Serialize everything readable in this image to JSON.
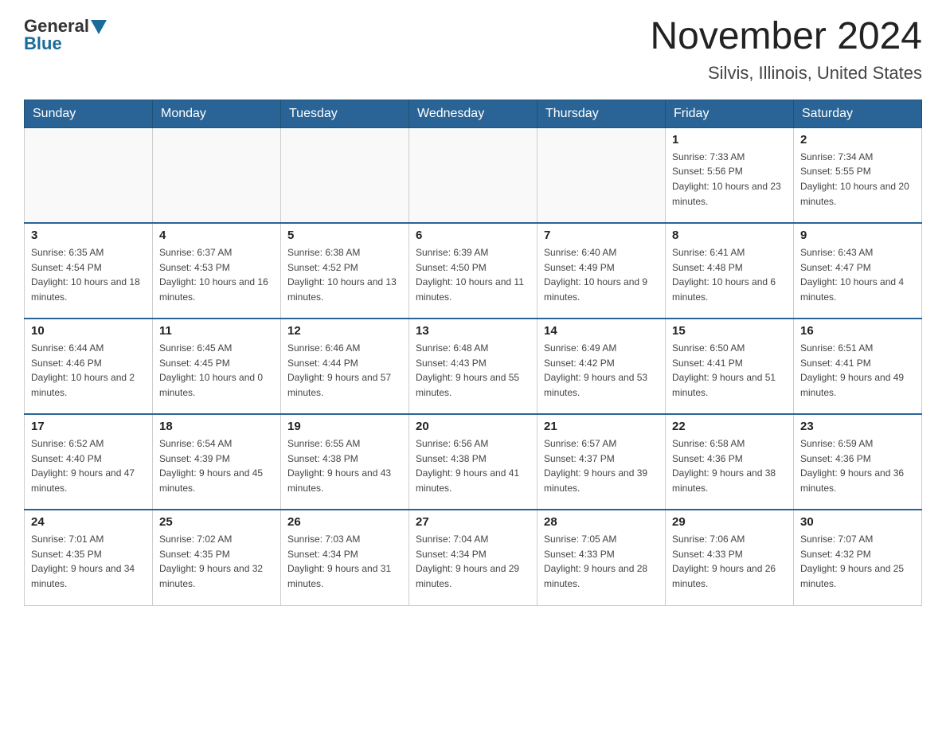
{
  "logo": {
    "general_text": "General",
    "blue_text": "Blue"
  },
  "header": {
    "month_year": "November 2024",
    "location": "Silvis, Illinois, United States"
  },
  "weekdays": [
    "Sunday",
    "Monday",
    "Tuesday",
    "Wednesday",
    "Thursday",
    "Friday",
    "Saturday"
  ],
  "weeks": [
    [
      {
        "day": "",
        "info": ""
      },
      {
        "day": "",
        "info": ""
      },
      {
        "day": "",
        "info": ""
      },
      {
        "day": "",
        "info": ""
      },
      {
        "day": "",
        "info": ""
      },
      {
        "day": "1",
        "info": "Sunrise: 7:33 AM\nSunset: 5:56 PM\nDaylight: 10 hours and 23 minutes."
      },
      {
        "day": "2",
        "info": "Sunrise: 7:34 AM\nSunset: 5:55 PM\nDaylight: 10 hours and 20 minutes."
      }
    ],
    [
      {
        "day": "3",
        "info": "Sunrise: 6:35 AM\nSunset: 4:54 PM\nDaylight: 10 hours and 18 minutes."
      },
      {
        "day": "4",
        "info": "Sunrise: 6:37 AM\nSunset: 4:53 PM\nDaylight: 10 hours and 16 minutes."
      },
      {
        "day": "5",
        "info": "Sunrise: 6:38 AM\nSunset: 4:52 PM\nDaylight: 10 hours and 13 minutes."
      },
      {
        "day": "6",
        "info": "Sunrise: 6:39 AM\nSunset: 4:50 PM\nDaylight: 10 hours and 11 minutes."
      },
      {
        "day": "7",
        "info": "Sunrise: 6:40 AM\nSunset: 4:49 PM\nDaylight: 10 hours and 9 minutes."
      },
      {
        "day": "8",
        "info": "Sunrise: 6:41 AM\nSunset: 4:48 PM\nDaylight: 10 hours and 6 minutes."
      },
      {
        "day": "9",
        "info": "Sunrise: 6:43 AM\nSunset: 4:47 PM\nDaylight: 10 hours and 4 minutes."
      }
    ],
    [
      {
        "day": "10",
        "info": "Sunrise: 6:44 AM\nSunset: 4:46 PM\nDaylight: 10 hours and 2 minutes."
      },
      {
        "day": "11",
        "info": "Sunrise: 6:45 AM\nSunset: 4:45 PM\nDaylight: 10 hours and 0 minutes."
      },
      {
        "day": "12",
        "info": "Sunrise: 6:46 AM\nSunset: 4:44 PM\nDaylight: 9 hours and 57 minutes."
      },
      {
        "day": "13",
        "info": "Sunrise: 6:48 AM\nSunset: 4:43 PM\nDaylight: 9 hours and 55 minutes."
      },
      {
        "day": "14",
        "info": "Sunrise: 6:49 AM\nSunset: 4:42 PM\nDaylight: 9 hours and 53 minutes."
      },
      {
        "day": "15",
        "info": "Sunrise: 6:50 AM\nSunset: 4:41 PM\nDaylight: 9 hours and 51 minutes."
      },
      {
        "day": "16",
        "info": "Sunrise: 6:51 AM\nSunset: 4:41 PM\nDaylight: 9 hours and 49 minutes."
      }
    ],
    [
      {
        "day": "17",
        "info": "Sunrise: 6:52 AM\nSunset: 4:40 PM\nDaylight: 9 hours and 47 minutes."
      },
      {
        "day": "18",
        "info": "Sunrise: 6:54 AM\nSunset: 4:39 PM\nDaylight: 9 hours and 45 minutes."
      },
      {
        "day": "19",
        "info": "Sunrise: 6:55 AM\nSunset: 4:38 PM\nDaylight: 9 hours and 43 minutes."
      },
      {
        "day": "20",
        "info": "Sunrise: 6:56 AM\nSunset: 4:38 PM\nDaylight: 9 hours and 41 minutes."
      },
      {
        "day": "21",
        "info": "Sunrise: 6:57 AM\nSunset: 4:37 PM\nDaylight: 9 hours and 39 minutes."
      },
      {
        "day": "22",
        "info": "Sunrise: 6:58 AM\nSunset: 4:36 PM\nDaylight: 9 hours and 38 minutes."
      },
      {
        "day": "23",
        "info": "Sunrise: 6:59 AM\nSunset: 4:36 PM\nDaylight: 9 hours and 36 minutes."
      }
    ],
    [
      {
        "day": "24",
        "info": "Sunrise: 7:01 AM\nSunset: 4:35 PM\nDaylight: 9 hours and 34 minutes."
      },
      {
        "day": "25",
        "info": "Sunrise: 7:02 AM\nSunset: 4:35 PM\nDaylight: 9 hours and 32 minutes."
      },
      {
        "day": "26",
        "info": "Sunrise: 7:03 AM\nSunset: 4:34 PM\nDaylight: 9 hours and 31 minutes."
      },
      {
        "day": "27",
        "info": "Sunrise: 7:04 AM\nSunset: 4:34 PM\nDaylight: 9 hours and 29 minutes."
      },
      {
        "day": "28",
        "info": "Sunrise: 7:05 AM\nSunset: 4:33 PM\nDaylight: 9 hours and 28 minutes."
      },
      {
        "day": "29",
        "info": "Sunrise: 7:06 AM\nSunset: 4:33 PM\nDaylight: 9 hours and 26 minutes."
      },
      {
        "day": "30",
        "info": "Sunrise: 7:07 AM\nSunset: 4:32 PM\nDaylight: 9 hours and 25 minutes."
      }
    ]
  ]
}
